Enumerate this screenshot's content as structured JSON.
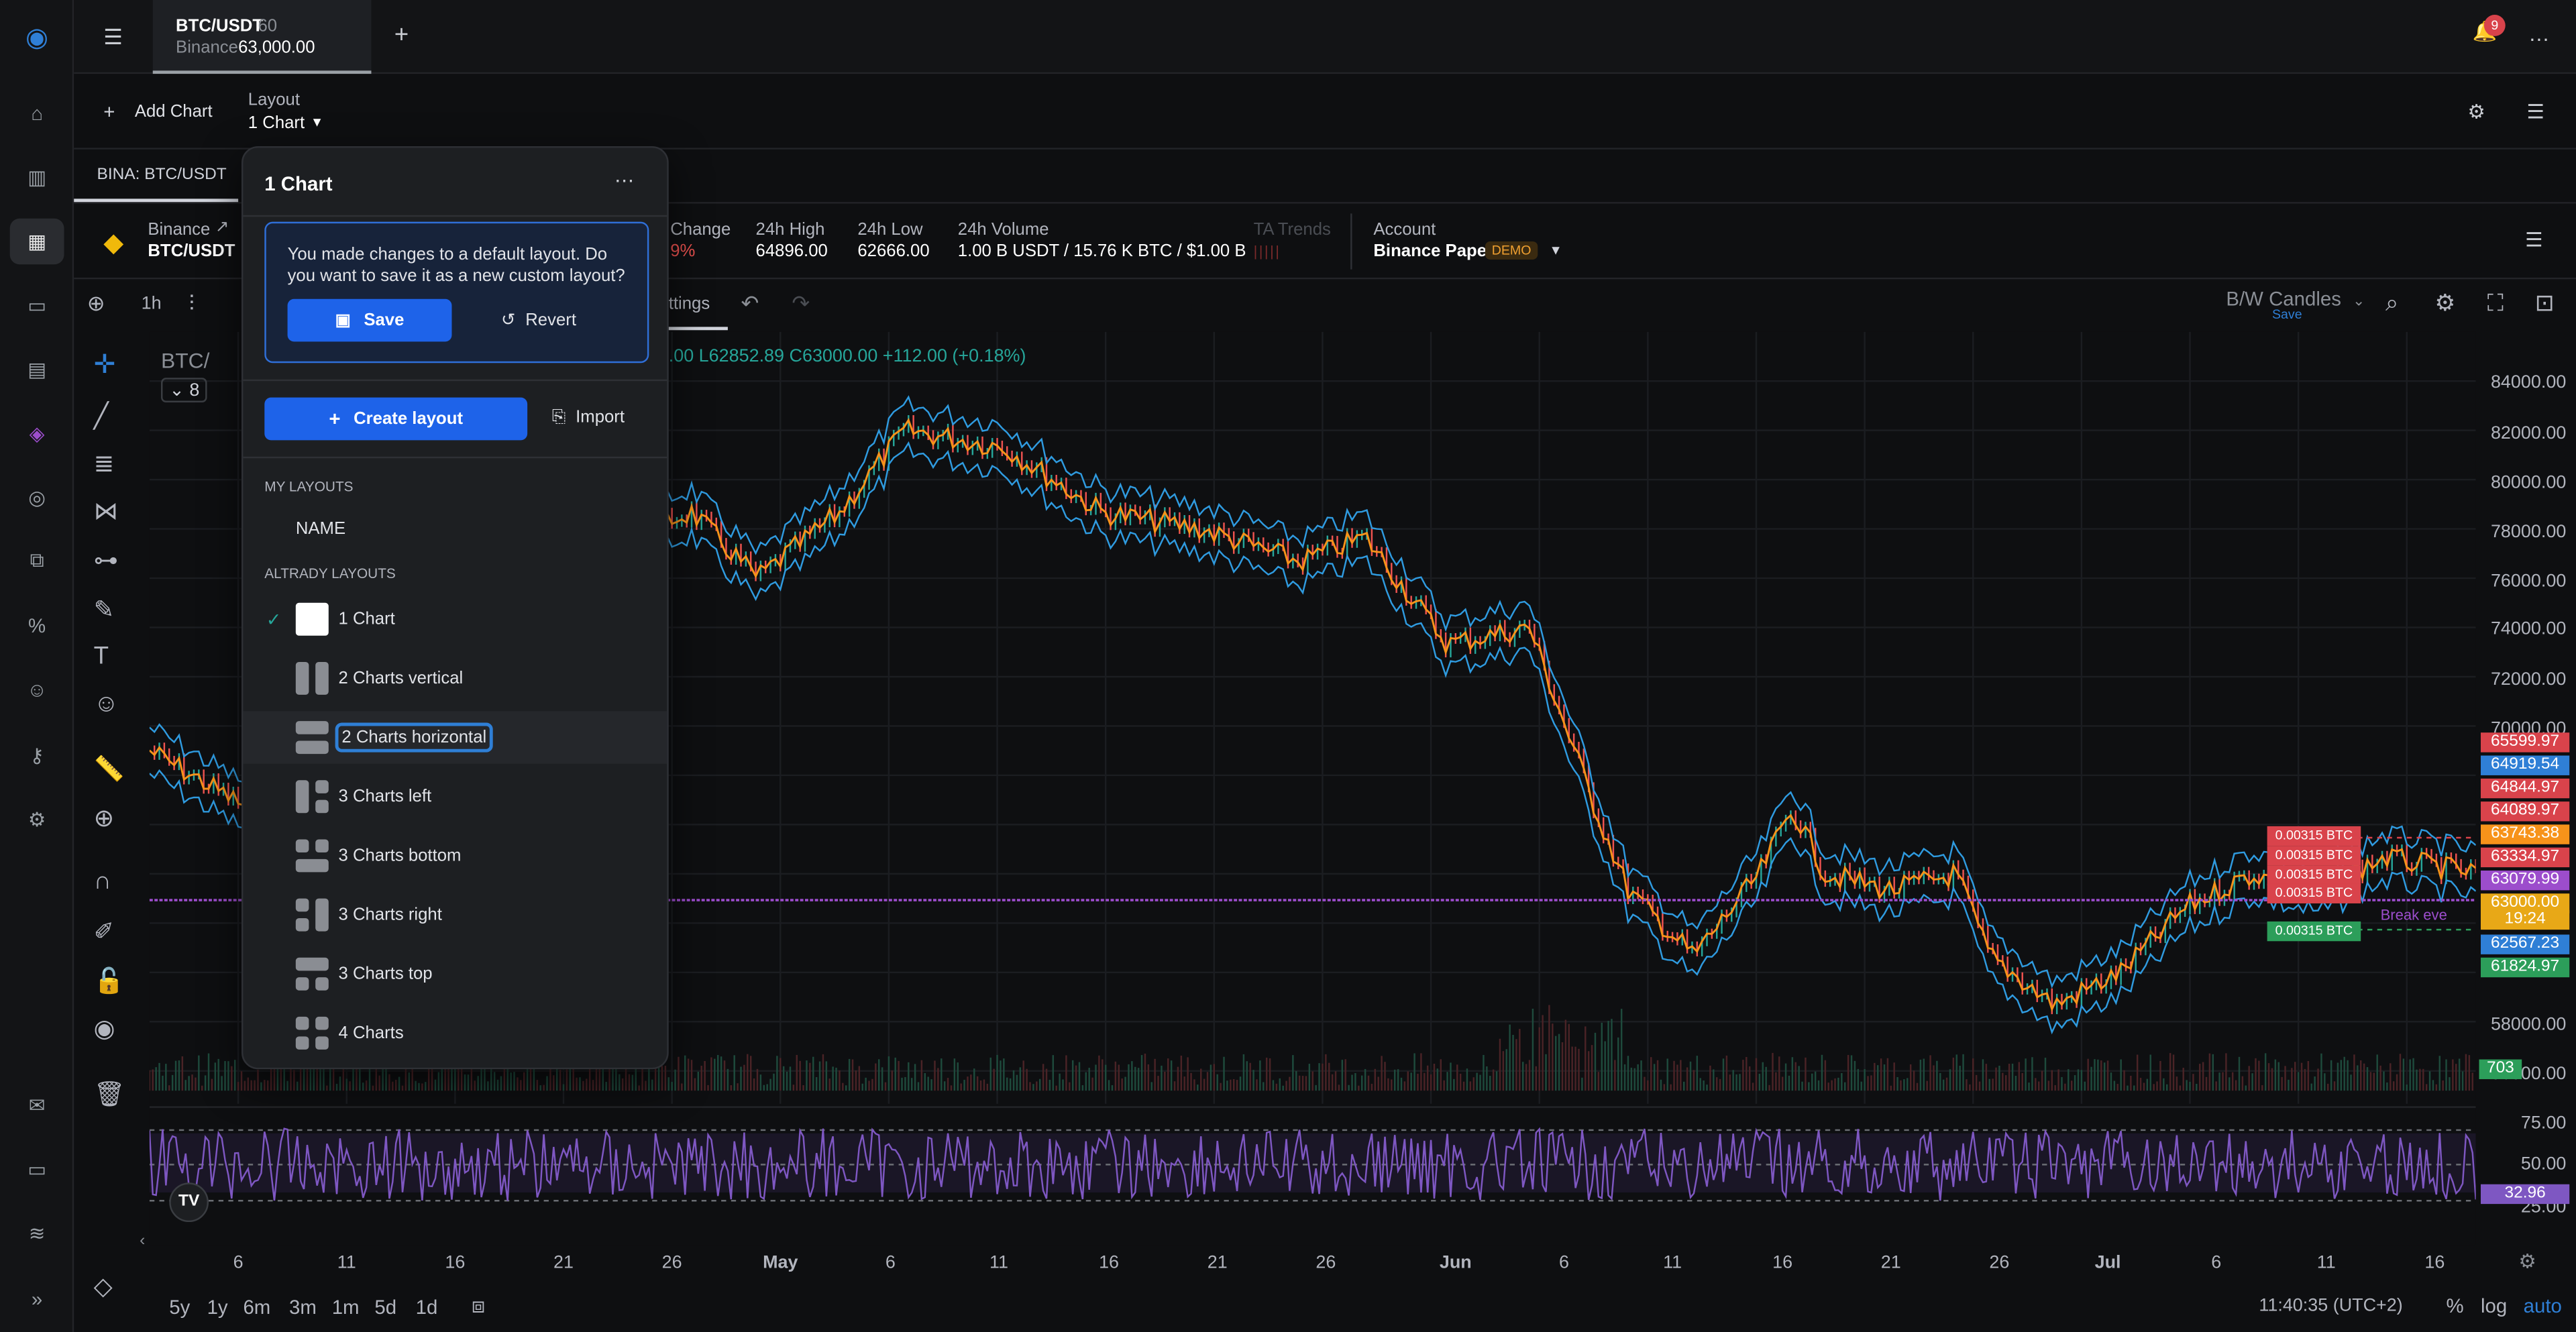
{
  "topbar": {
    "tab_symbol": "BTC/USDT",
    "tab_interval": "60",
    "tab_exchange": "Binance",
    "tab_price": "63,000.00",
    "add_tab": "+",
    "notification_count": "9",
    "more": "…"
  },
  "layoutbar": {
    "add_chart": "Add Chart",
    "layout_label": "Layout",
    "layout_value": "1 Chart"
  },
  "chart_tab": "BINA: BTC/USDT",
  "info": {
    "exchange": "Binance",
    "pair": "BTC/USDT",
    "change_label": "Change",
    "change_value": "9%",
    "high_label": "24h High",
    "high_value": "64896.00",
    "low_label": "24h Low",
    "low_value": "62666.00",
    "volume_label": "24h Volume",
    "volume_value": "1.00 B USDT / 15.76 K BTC / $1.00 B",
    "ta_label": "TA Trends",
    "account_label": "Account",
    "account_value": "Binance Paper",
    "demo_badge": "DEMO"
  },
  "toolbar": {
    "interval": "1h",
    "settings_tab": "ttings",
    "style_label": "B/W Candles",
    "save_hint": "Save"
  },
  "legend": {
    "symbol": "BTC/",
    "ohlc": ".00 L62852.89 C63000.00 +112.00 (+0.18%)",
    "collapsed_count": "8"
  },
  "dropdown": {
    "title": "1 Chart",
    "notice": "You made changes to a default layout. Do you want to save it as a new custom layout?",
    "save": "Save",
    "revert": "Revert",
    "create_layout": "Create layout",
    "import": "Import",
    "my_layouts_header": "MY LAYOUTS",
    "my_layout_name": "NAME",
    "altrady_header": "ALTRADY LAYOUTS",
    "layouts": [
      {
        "label": "1 Chart"
      },
      {
        "label": "2 Charts vertical"
      },
      {
        "label": "2 Charts horizontal"
      },
      {
        "label": "3 Charts left"
      },
      {
        "label": "3 Charts bottom"
      },
      {
        "label": "3 Charts right"
      },
      {
        "label": "3 Charts top"
      },
      {
        "label": "4 Charts"
      }
    ]
  },
  "yaxis": [
    "84000.00",
    "82000.00",
    "80000.00",
    "78000.00",
    "76000.00",
    "74000.00",
    "72000.00",
    "70000.00",
    "58000.00",
    "56000.00"
  ],
  "rsi_axis": [
    "75.00",
    "50.00",
    "25.00"
  ],
  "price_tags": [
    {
      "value": "65599.97",
      "color": "#d9434b"
    },
    {
      "value": "64919.54",
      "color": "#2f7fd6"
    },
    {
      "value": "64844.97",
      "color": "#d9434b"
    },
    {
      "value": "64089.97",
      "color": "#d9434b"
    },
    {
      "value": "63743.38",
      "color": "#f7931a"
    },
    {
      "value": "63334.97",
      "color": "#d9434b"
    },
    {
      "value": "63079.99",
      "color": "#9c4dcc"
    },
    {
      "value": "63000.00",
      "color": "#e8a817"
    },
    {
      "value": "19:24",
      "color": "#e8a817"
    },
    {
      "value": "62567.23",
      "color": "#2f7fd6"
    },
    {
      "value": "61824.97",
      "color": "#2c9e5a"
    }
  ],
  "order_tags": [
    "0.00315 BTC",
    "0.00315 BTC",
    "0.00315 BTC",
    "0.00315 BTC",
    "0.00315 BTC"
  ],
  "break_even": "Break eve",
  "volume_tag": "703",
  "rsi_tag": "32.96",
  "xaxis": [
    "6",
    "11",
    "16",
    "21",
    "26",
    "May",
    "6",
    "11",
    "16",
    "21",
    "26",
    "Jun",
    "6",
    "11",
    "16",
    "21",
    "26",
    "Jul",
    "6",
    "11",
    "16"
  ],
  "bottom": {
    "ranges": [
      "5y",
      "1y",
      "6m",
      "3m",
      "1m",
      "5d",
      "1d"
    ],
    "time": "11:40:35 (UTC+2)",
    "pct": "%",
    "log": "log",
    "auto": "auto"
  },
  "colors": {
    "accent": "#1e63e9",
    "up": "#26a69a",
    "down": "#ef5350",
    "band": "#2f9be0",
    "ma": "#f7931a",
    "rsi": "#7e57c2"
  }
}
